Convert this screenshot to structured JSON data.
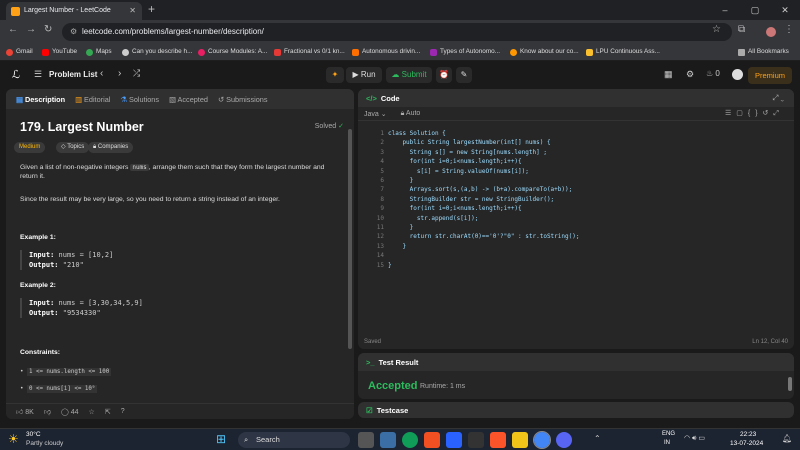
{
  "browser": {
    "tab_title": "Largest Number - LeetCode",
    "url": "leetcode.com/problems/largest-number/description/",
    "bookmarks": [
      "Gmail",
      "YouTube",
      "Maps",
      "Can you describe h...",
      "Course Modules: A...",
      "Fractional vs 0/1 kn...",
      "Autonomous drivin...",
      "Types of Autonomo...",
      "Know about our co...",
      "LPU Continuous Ass...",
      "All Bookmarks"
    ]
  },
  "toolbar": {
    "problem_list": "Problem List",
    "run": "Run",
    "submit": "Submit",
    "streak": "0",
    "premium": "Premium"
  },
  "tabs": [
    "Description",
    "Editorial",
    "Solutions",
    "Accepted",
    "Submissions"
  ],
  "problem": {
    "title": "179. Largest Number",
    "status": "Solved",
    "difficulty": "Medium",
    "topics": "Topics",
    "companies": "Companies",
    "desc1_a": "Given a list of non-negative integers ",
    "desc1_code": "nums",
    "desc1_b": ", arrange them such that they form the largest number and return it.",
    "desc2": "Since the result may be very large, so you need to return a string instead of an integer.",
    "ex1_label": "Example 1:",
    "ex1_input_k": "Input:",
    "ex1_input": " nums = [10,2]",
    "ex1_output_k": "Output:",
    "ex1_output": " \"210\"",
    "ex2_label": "Example 2:",
    "ex2_input_k": "Input:",
    "ex2_input": " nums = [3,30,34,5,9]",
    "ex2_output_k": "Output:",
    "ex2_output": " \"9534330\"",
    "constraints_label": "Constraints:",
    "c1": "1 <= nums.length <= 100",
    "c2": "0 <= nums[i] <= 10⁹"
  },
  "footer": {
    "likes": "8K",
    "comments": "44"
  },
  "editor": {
    "title": "Code",
    "lang": "Java",
    "mode": "Auto",
    "lines": [
      "class Solution {",
      "    public String largestNumber(int[] nums) {",
      "      String s[] = new String[nums.length] ;",
      "      for(int i=0;i<nums.length;i++){",
      "        s[i] = String.valueOf(nums[i]);",
      "      }",
      "      Arrays.sort(s,(a,b) -> (b+a).compareTo(a+b));",
      "      StringBuilder str = new StringBuilder();",
      "      for(int i=0;i<nums.length;i++){",
      "        str.append(s[i]);",
      "      }",
      "      return str.charAt(0)=='0'?\"0\" : str.toString();",
      "    }",
      "",
      "}"
    ],
    "saved": "Saved",
    "cursor": "Ln 12, Col 40"
  },
  "result": {
    "title": "Test Result",
    "status": "Accepted",
    "runtime": "Runtime: 1 ms",
    "testcase": "Testcase"
  },
  "taskbar": {
    "weather_temp": "30°C",
    "weather_desc": "Partly cloudy",
    "search": "Search",
    "lang": "ENG",
    "region": "IN",
    "time": "22:23",
    "date": "13-07-2024"
  }
}
